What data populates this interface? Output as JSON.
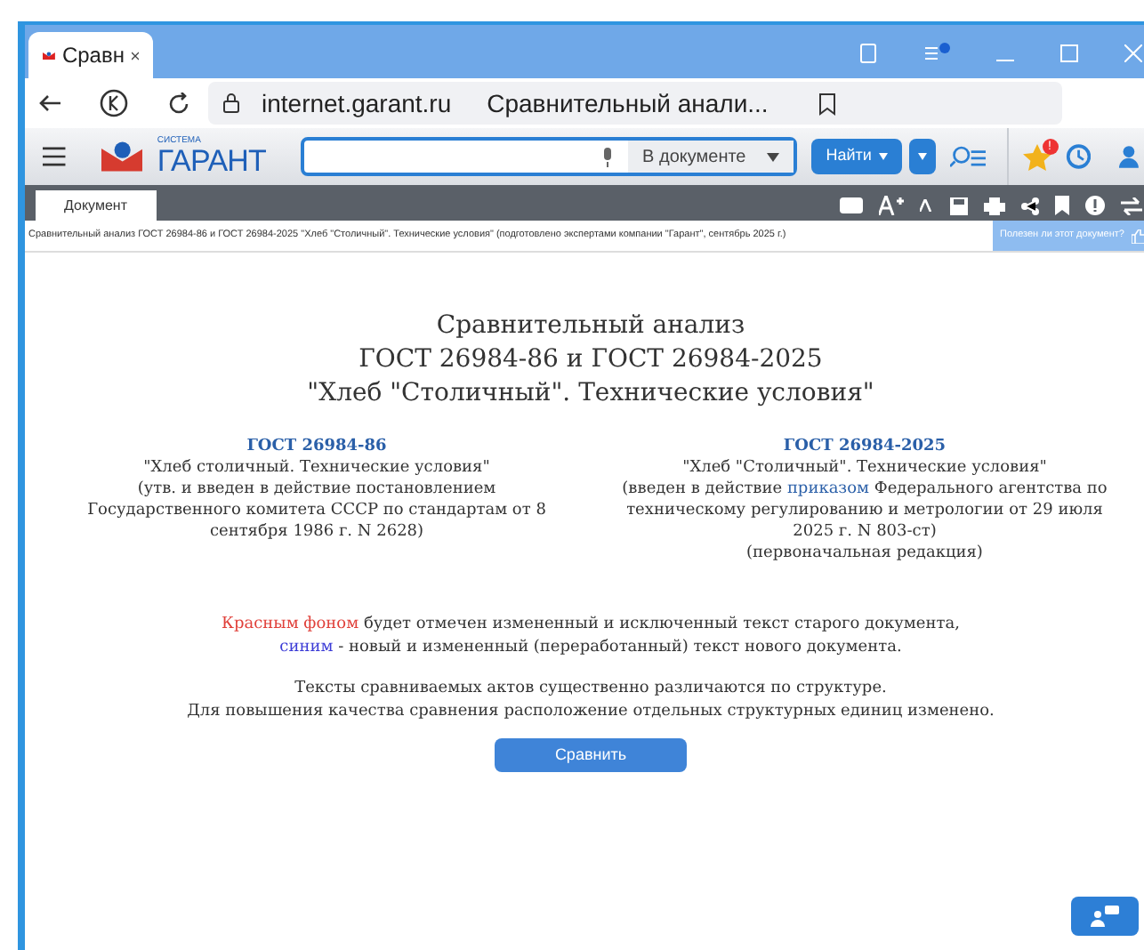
{
  "browser": {
    "tab": {
      "title": "Сравн",
      "selected": true
    },
    "url": "internet.garant.ru",
    "page_title": "Сравнительный анали..."
  },
  "garant": {
    "logo_small": "СИСТЕМА",
    "logo": "ГАРАНТ",
    "search": {
      "scope": "В документе"
    },
    "find_button": "Найти",
    "favorites_badge": "!"
  },
  "doc_tab": {
    "label": "Документ",
    "selected": true
  },
  "info": {
    "text": "Сравнительный анализ ГОСТ 26984-86 и ГОСТ 26984-2025 \"Хлеб \"Столичный\". Технические условия\" (подготовлено экспертами компании \"Гарант\", сентябрь 2025 г.)",
    "feedback": "Полезен ли этот документ?"
  },
  "title_lines": [
    "Сравнительный анализ",
    "ГОСТ 26984-86 и ГОСТ 26984-2025",
    "\"Хлеб \"Столичный\". Технические условия\""
  ],
  "documents": [
    {
      "link": "ГОСТ 26984-86",
      "name": "\"Хлеб столичный. Технические условия\"",
      "note_before": "(утв. и введен в действие постановлением Государственного комитета СССР по стандартам от 8 сентября 1986 г. N 2628)"
    },
    {
      "link": "ГОСТ 26984-2025",
      "name": "\"Хлеб \"Столичный\". Технические условия\"",
      "note_before": "(введен в действие ",
      "note_link": "приказом",
      "note_after": " Федерального агентства по техническому регулированию и метрологии от 29 июля 2025 г. N 803-ст)",
      "edition": "(первоначальная редакция)"
    }
  ],
  "legend": [
    {
      "highlight": "Красным фоном",
      "color": "#e0403a",
      "rest": " будет отмечен измененный и исключенный текст старого документа,"
    },
    {
      "highlight": "синим",
      "color": "#3b3bd6",
      "rest": " - новый и измененный (переработанный) текст нового документа."
    }
  ],
  "notes": [
    "Тексты сравниваемых актов существенно различаются по структуре.",
    "Для повышения качества сравнения расположение отдельных структурных единиц изменено."
  ],
  "compare_button": "Сравнить"
}
